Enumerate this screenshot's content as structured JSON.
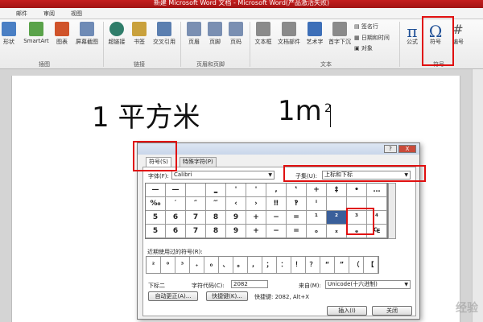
{
  "window": {
    "title": "新建 Microsoft Word 文档 - Microsoft Word(产品激活失败)"
  },
  "tabs": [
    "邮件",
    "审阅",
    "视图"
  ],
  "ribbon": {
    "buttons": [
      {
        "label": "形状",
        "icon": "shapes-icon",
        "color": "#4a7fc4"
      },
      {
        "label": "SmartArt",
        "icon": "smartart-icon",
        "color": "#5aa34a"
      },
      {
        "label": "图表",
        "icon": "chart-icon",
        "color": "#d0532a"
      },
      {
        "label": "屏幕截图",
        "icon": "screenshot-icon",
        "color": "#6f8bb6"
      },
      {
        "label": "超链接",
        "icon": "hyperlink-icon",
        "color": "#2f7d6a"
      },
      {
        "label": "书签",
        "icon": "bookmark-icon",
        "color": "#c9a13c"
      },
      {
        "label": "交叉引用",
        "icon": "crossref-icon",
        "color": "#5b7fb0"
      },
      {
        "label": "页眉",
        "icon": "header-icon",
        "color": "#7a8fb2"
      },
      {
        "label": "页脚",
        "icon": "footer-icon",
        "color": "#7a8fb2"
      },
      {
        "label": "页码",
        "icon": "pagenumber-icon",
        "color": "#7a8fb2"
      },
      {
        "label": "文本框",
        "icon": "textbox-icon",
        "color": "#8a8a8a"
      },
      {
        "label": "文档部件",
        "icon": "quickparts-icon",
        "color": "#8a8a8a"
      },
      {
        "label": "艺术字",
        "icon": "wordart-icon",
        "color": "#3d6fb8"
      },
      {
        "label": "首字下沉",
        "icon": "dropcap-icon",
        "color": "#8a8a8a"
      },
      {
        "label": "公式",
        "icon": "pi-icon",
        "glyph": "π",
        "color": "#1f4f96"
      },
      {
        "label": "符号",
        "icon": "omega-icon",
        "glyph": "Ω",
        "color": "#1f4f96"
      },
      {
        "label": "编号",
        "icon": "number-icon",
        "glyph": "#",
        "color": "#555555"
      }
    ],
    "small": [
      "签名行",
      "日期和时间",
      "对象"
    ],
    "groups": [
      "插图",
      "链接",
      "页眉和页脚",
      "文本",
      "符号"
    ]
  },
  "document": {
    "text_main": "1 平方米",
    "text_m": "1m",
    "text_sup": "2"
  },
  "dialog": {
    "title_buttons": [
      "?",
      "X"
    ],
    "tabs": [
      "符号(S)",
      "特殊字符(P)"
    ],
    "font_label": "字体(F):",
    "font_value": "Calibri",
    "subset_label": "子集(U):",
    "subset_value": "上标和下标",
    "grid": [
      [
        "—",
        "—",
        "",
        "‗",
        "'",
        "'",
        "‚",
        "‛",
        "\"",
        "\"",
        "„",
        "‟"
      ],
      [
        "‰",
        "′",
        "″",
        "‴",
        "‹",
        "›",
        "‼",
        "‽",
        "‾",
        "⁄",
        "",
        "⁰"
      ],
      [
        "5",
        "6",
        "7",
        "8",
        "9",
        "+",
        "−",
        "=",
        "(",
        ")",
        "n",
        "0"
      ],
      [
        "5",
        "6",
        "7",
        "8",
        "9",
        "+",
        "−",
        "=",
        "(",
        ")",
        "a",
        "e"
      ]
    ],
    "grid_extra": [
      [
        "+",
        "‡",
        "•",
        "…"
      ],
      [
        "ⁱ",
        "",
        "",
        ""
      ],
      [
        "¹",
        "²",
        "³",
        "⁴"
      ],
      [
        "ₒ",
        "ₓ",
        "ₔ",
        "₠"
      ]
    ],
    "recent_label": "近期使用过的符号(R):",
    "recent": [
      "²",
      "⁰",
      "³",
      "₊",
      "₀",
      "、",
      "。",
      "，",
      "；",
      "：",
      "！",
      "？",
      "“",
      "”",
      "（",
      "【"
    ],
    "char_name": "下标二",
    "code_label": "字符代码(C):",
    "code_value": "2082",
    "from_label": "来自(M):",
    "from_value": "Unicode(十六进制)",
    "autocorrect": "自动更正(A)...",
    "shortcut_button": "快捷键(K)...",
    "shortcut_text": "快捷键: 2082, Alt+X",
    "insert": "插入(I)",
    "close": "关闭"
  },
  "watermark": "经验"
}
